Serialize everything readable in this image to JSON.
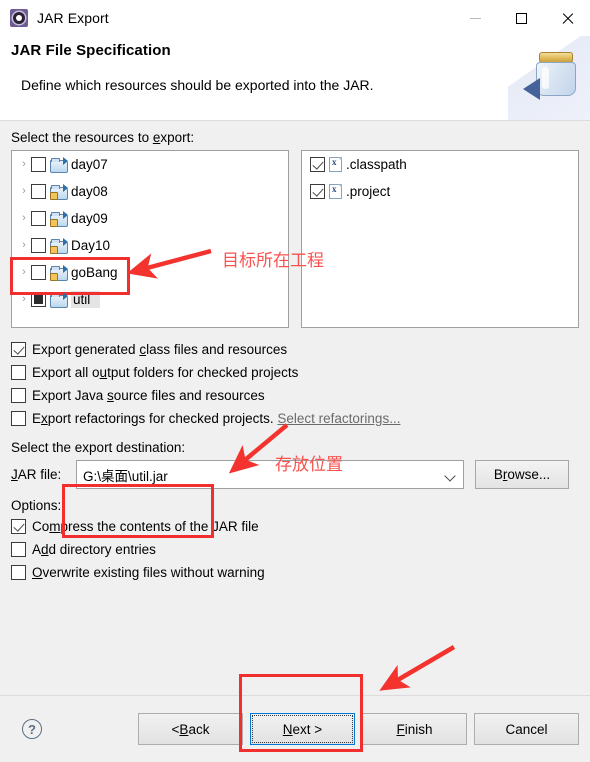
{
  "window": {
    "title": "JAR Export",
    "app_icon": "gear-icon",
    "controls": {
      "minimize": "minimize-icon",
      "maximize": "maximize-icon",
      "close": "close-icon"
    }
  },
  "banner": {
    "heading": "JAR File Specification",
    "description": "Define which resources should be exported into the JAR.",
    "art_icon": "jar-image"
  },
  "resources": {
    "label_prefix": "Select the resources to ",
    "label_mnemonic": "e",
    "label_suffix": "xport:",
    "tree_items": [
      {
        "name": "day07",
        "checked": false,
        "partial": false,
        "locked": false,
        "selected": false,
        "icon": "folder-icon"
      },
      {
        "name": "day08",
        "checked": false,
        "partial": false,
        "locked": true,
        "selected": false,
        "icon": "folder-icon"
      },
      {
        "name": "day09",
        "checked": false,
        "partial": false,
        "locked": true,
        "selected": false,
        "icon": "folder-icon"
      },
      {
        "name": "Day10",
        "checked": false,
        "partial": false,
        "locked": true,
        "selected": false,
        "icon": "folder-icon"
      },
      {
        "name": "goBang",
        "checked": false,
        "partial": false,
        "locked": true,
        "selected": false,
        "icon": "folder-icon"
      },
      {
        "name": "util",
        "checked": false,
        "partial": true,
        "locked": false,
        "selected": true,
        "icon": "folder-open-icon"
      }
    ],
    "file_items": [
      {
        "name": ".classpath",
        "checked": true,
        "icon": "xml-file-icon"
      },
      {
        "name": ".project",
        "checked": true,
        "icon": "xml-file-icon"
      }
    ]
  },
  "export_options": [
    {
      "pre": "Export generated ",
      "mn": "c",
      "post": "lass files and resources",
      "checked": true
    },
    {
      "pre": "Export all o",
      "mn": "u",
      "post": "tput folders for checked projects",
      "checked": false
    },
    {
      "pre": "Export Java ",
      "mn": "s",
      "post": "ource files and resources",
      "checked": false
    },
    {
      "pre": "E",
      "mn": "x",
      "post": "port refactorings for checked projects.",
      "checked": false,
      "link": "Select refactorings..."
    }
  ],
  "destination": {
    "label_pre": "Select the export destination:",
    "jar_file_label_pre": "J",
    "jar_file_label_mn": "A",
    "jar_file_label_post": "R file:",
    "jar_file_value": "G:\\桌面\\util.jar",
    "browse_pre": "B",
    "browse_mn": "r",
    "browse_post": "owse..."
  },
  "options": {
    "label": "Options:",
    "items": [
      {
        "pre": "Co",
        "mn": "m",
        "post": "press the contents of the JAR file",
        "checked": true
      },
      {
        "pre": "A",
        "mn": "d",
        "post": "d directory entries",
        "checked": false
      },
      {
        "pre": "",
        "mn": "O",
        "post": "verwrite existing files without warning",
        "checked": false
      }
    ]
  },
  "footer": {
    "help_icon": "help-icon",
    "buttons": [
      {
        "pre": "< ",
        "mn": "B",
        "post": "ack",
        "focused": false
      },
      {
        "pre": "",
        "mn": "N",
        "post": "ext >",
        "focused": true
      },
      {
        "pre": "",
        "mn": "F",
        "post": "inish",
        "focused": false
      },
      {
        "pre": "Cancel",
        "mn": "",
        "post": "",
        "focused": false
      }
    ]
  },
  "annotations": {
    "project_note": "目标所在工程",
    "location_note": "存放位置",
    "color": "#f9534f",
    "box_color": "#f22f2f"
  }
}
